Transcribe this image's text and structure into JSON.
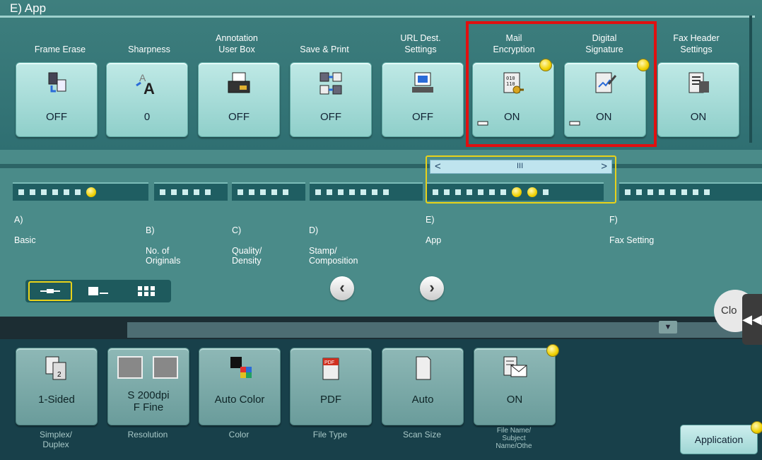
{
  "header": {
    "title": "E)  App"
  },
  "functions": [
    {
      "label": "Frame Erase",
      "value": "OFF",
      "icon": "frame-erase-icon"
    },
    {
      "label": "Sharpness",
      "value": "0",
      "icon": "sharpness-icon"
    },
    {
      "label": "Annotation\nUser Box",
      "value": "OFF",
      "icon": "annotation-icon"
    },
    {
      "label": "Save & Print",
      "value": "OFF",
      "icon": "save-print-icon"
    },
    {
      "label": "URL Dest.\nSettings",
      "value": "OFF",
      "icon": "url-dest-icon"
    },
    {
      "label": "Mail\nEncryption",
      "value": "ON",
      "icon": "mail-encryption-icon",
      "locked": true,
      "indicator": true
    },
    {
      "label": "Digital\nSignature",
      "value": "ON",
      "icon": "digital-signature-icon",
      "locked": true,
      "indicator": true
    },
    {
      "label": "Fax Header\nSettings",
      "value": "ON",
      "icon": "fax-header-icon"
    }
  ],
  "categories": [
    {
      "letter": "A)",
      "name": "Basic"
    },
    {
      "letter": "B)",
      "name": "No. of\nOriginals"
    },
    {
      "letter": "C)",
      "name": "Quality/\nDensity"
    },
    {
      "letter": "D)",
      "name": "Stamp/\nComposition"
    },
    {
      "letter": "E)",
      "name": "App"
    },
    {
      "letter": "F)",
      "name": "Fax Setting"
    }
  ],
  "scrollbar": {
    "left": "<",
    "middle": "III",
    "right": ">"
  },
  "nav": {
    "prev": "‹",
    "next": "›",
    "close": "Clo",
    "side": "◀◀"
  },
  "status": [
    {
      "value": "1-Sided",
      "label": "Simplex/\nDuplex"
    },
    {
      "value": "S 200dpi\nF Fine",
      "label": "Resolution"
    },
    {
      "value": "Auto Color",
      "label": "Color"
    },
    {
      "value": "PDF",
      "label": "File Type"
    },
    {
      "value": "Auto",
      "label": "Scan Size"
    },
    {
      "value": "ON",
      "label": "File Name/\nSubject\nName/Othe"
    }
  ],
  "application_button": "Application",
  "colors": {
    "highlight": "#e01010",
    "selected": "#e8d21a",
    "indicator": "#f0d000"
  }
}
